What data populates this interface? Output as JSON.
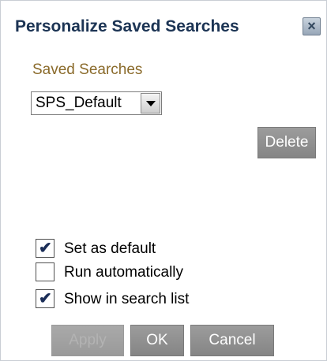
{
  "dialog": {
    "title": "Personalize Saved Searches",
    "close_glyph": "×"
  },
  "saved_searches": {
    "label": "Saved Searches",
    "selected": "SPS_Default"
  },
  "buttons": {
    "delete": "Delete",
    "apply": "Apply",
    "ok": "OK",
    "cancel": "Cancel"
  },
  "options": [
    {
      "label": "Set as default",
      "checked": true
    },
    {
      "label": "Run automatically",
      "checked": false
    },
    {
      "label": "Show in search list",
      "checked": true
    }
  ],
  "check_glyph": "✔",
  "colors": {
    "title": "#1c3454",
    "section_label": "#8a6a2a",
    "button": "#8f8f8f"
  }
}
